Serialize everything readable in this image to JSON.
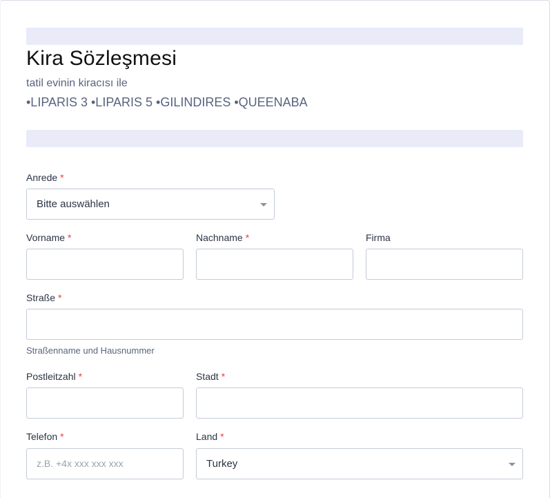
{
  "form": {
    "title": "Kira Sözleşmesi",
    "subtitle": "tatil evinin kiracısı ile",
    "properties": "•LIPARIS 3 •LIPARIS 5 •GILINDIRES •QUEENABA"
  },
  "fields": {
    "salutation": {
      "label": "Anrede",
      "required": "*",
      "value": "Bitte auswählen"
    },
    "first_name": {
      "label": "Vorname",
      "required": "*",
      "value": ""
    },
    "last_name": {
      "label": "Nachname",
      "required": "*",
      "value": ""
    },
    "company": {
      "label": "Firma",
      "value": ""
    },
    "street": {
      "label": "Straße",
      "required": "*",
      "value": "",
      "hint": "Straßenname und Hausnummer"
    },
    "postal_code": {
      "label": "Postleitzahl",
      "required": "*",
      "value": ""
    },
    "city": {
      "label": "Stadt",
      "required": "*",
      "value": ""
    },
    "phone": {
      "label": "Telefon",
      "required": "*",
      "value": "",
      "placeholder": "z.B. +4x xxx xxx xxx"
    },
    "country": {
      "label": "Land",
      "required": "*",
      "value": "Turkey"
    }
  },
  "colors": {
    "band": "#e9ebf9",
    "required": "#f23a3c",
    "border": "#c3cad8"
  },
  "icons": {
    "dropdown": "chevron-down-icon"
  }
}
